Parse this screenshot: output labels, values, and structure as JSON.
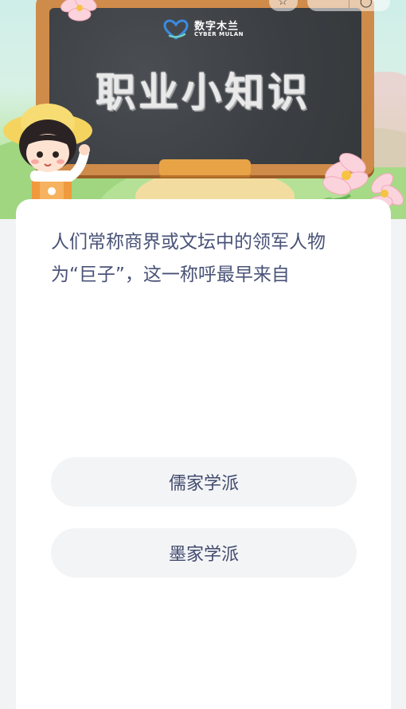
{
  "banner": {
    "logo_cn": "数字木兰",
    "logo_en": "CYBER MULAN",
    "board_title": "职业小知识"
  },
  "question": {
    "text": "人们常称商界或文坛中的领军人物为“巨子”，这一称呼最早来自"
  },
  "options": [
    {
      "label": "儒家学派"
    },
    {
      "label": "墨家学派"
    }
  ],
  "colors": {
    "question_text": "#4a5378",
    "option_bg": "#f3f4f6",
    "board": "#3d4145",
    "frame": "#cf8b4a"
  },
  "icons": {
    "top_left_control": "star-icon",
    "top_right_control": "circle-icon"
  }
}
